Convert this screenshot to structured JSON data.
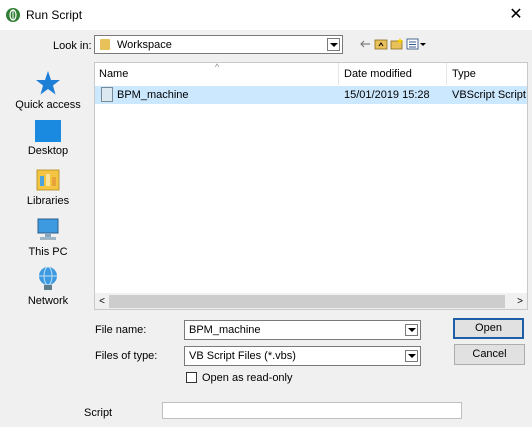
{
  "window": {
    "title": "Run Script",
    "close_glyph": "✕"
  },
  "lookin": {
    "label": "Look in:",
    "value": "Workspace"
  },
  "toolbar_icons": [
    "back-icon",
    "up-folder-icon",
    "new-folder-icon",
    "view-menu-icon"
  ],
  "places": [
    {
      "label": "Quick access",
      "icon": "star-icon"
    },
    {
      "label": "Desktop",
      "icon": "desktop-icon"
    },
    {
      "label": "Libraries",
      "icon": "libraries-icon"
    },
    {
      "label": "This PC",
      "icon": "computer-icon"
    },
    {
      "label": "Network",
      "icon": "network-icon"
    }
  ],
  "filelist": {
    "columns": [
      "Name",
      "Date modified",
      "Type"
    ],
    "rows": [
      {
        "name": "BPM_machine",
        "date": "15/01/2019 15:28",
        "type": "VBScript Script File"
      }
    ],
    "selected_row_color": "#cce8ff"
  },
  "filename": {
    "label": "File name:",
    "value": "BPM_machine"
  },
  "filetype": {
    "label": "Files of type:",
    "value": "VB Script Files (*.vbs)"
  },
  "readonly": {
    "label": "Open as read-only",
    "checked": false
  },
  "buttons": {
    "open": "Open",
    "cancel": "Cancel"
  },
  "script": {
    "label": "Script",
    "value": ""
  },
  "colors": {
    "accent": "#1f5fa8",
    "app_icon": "#2e7d32"
  }
}
